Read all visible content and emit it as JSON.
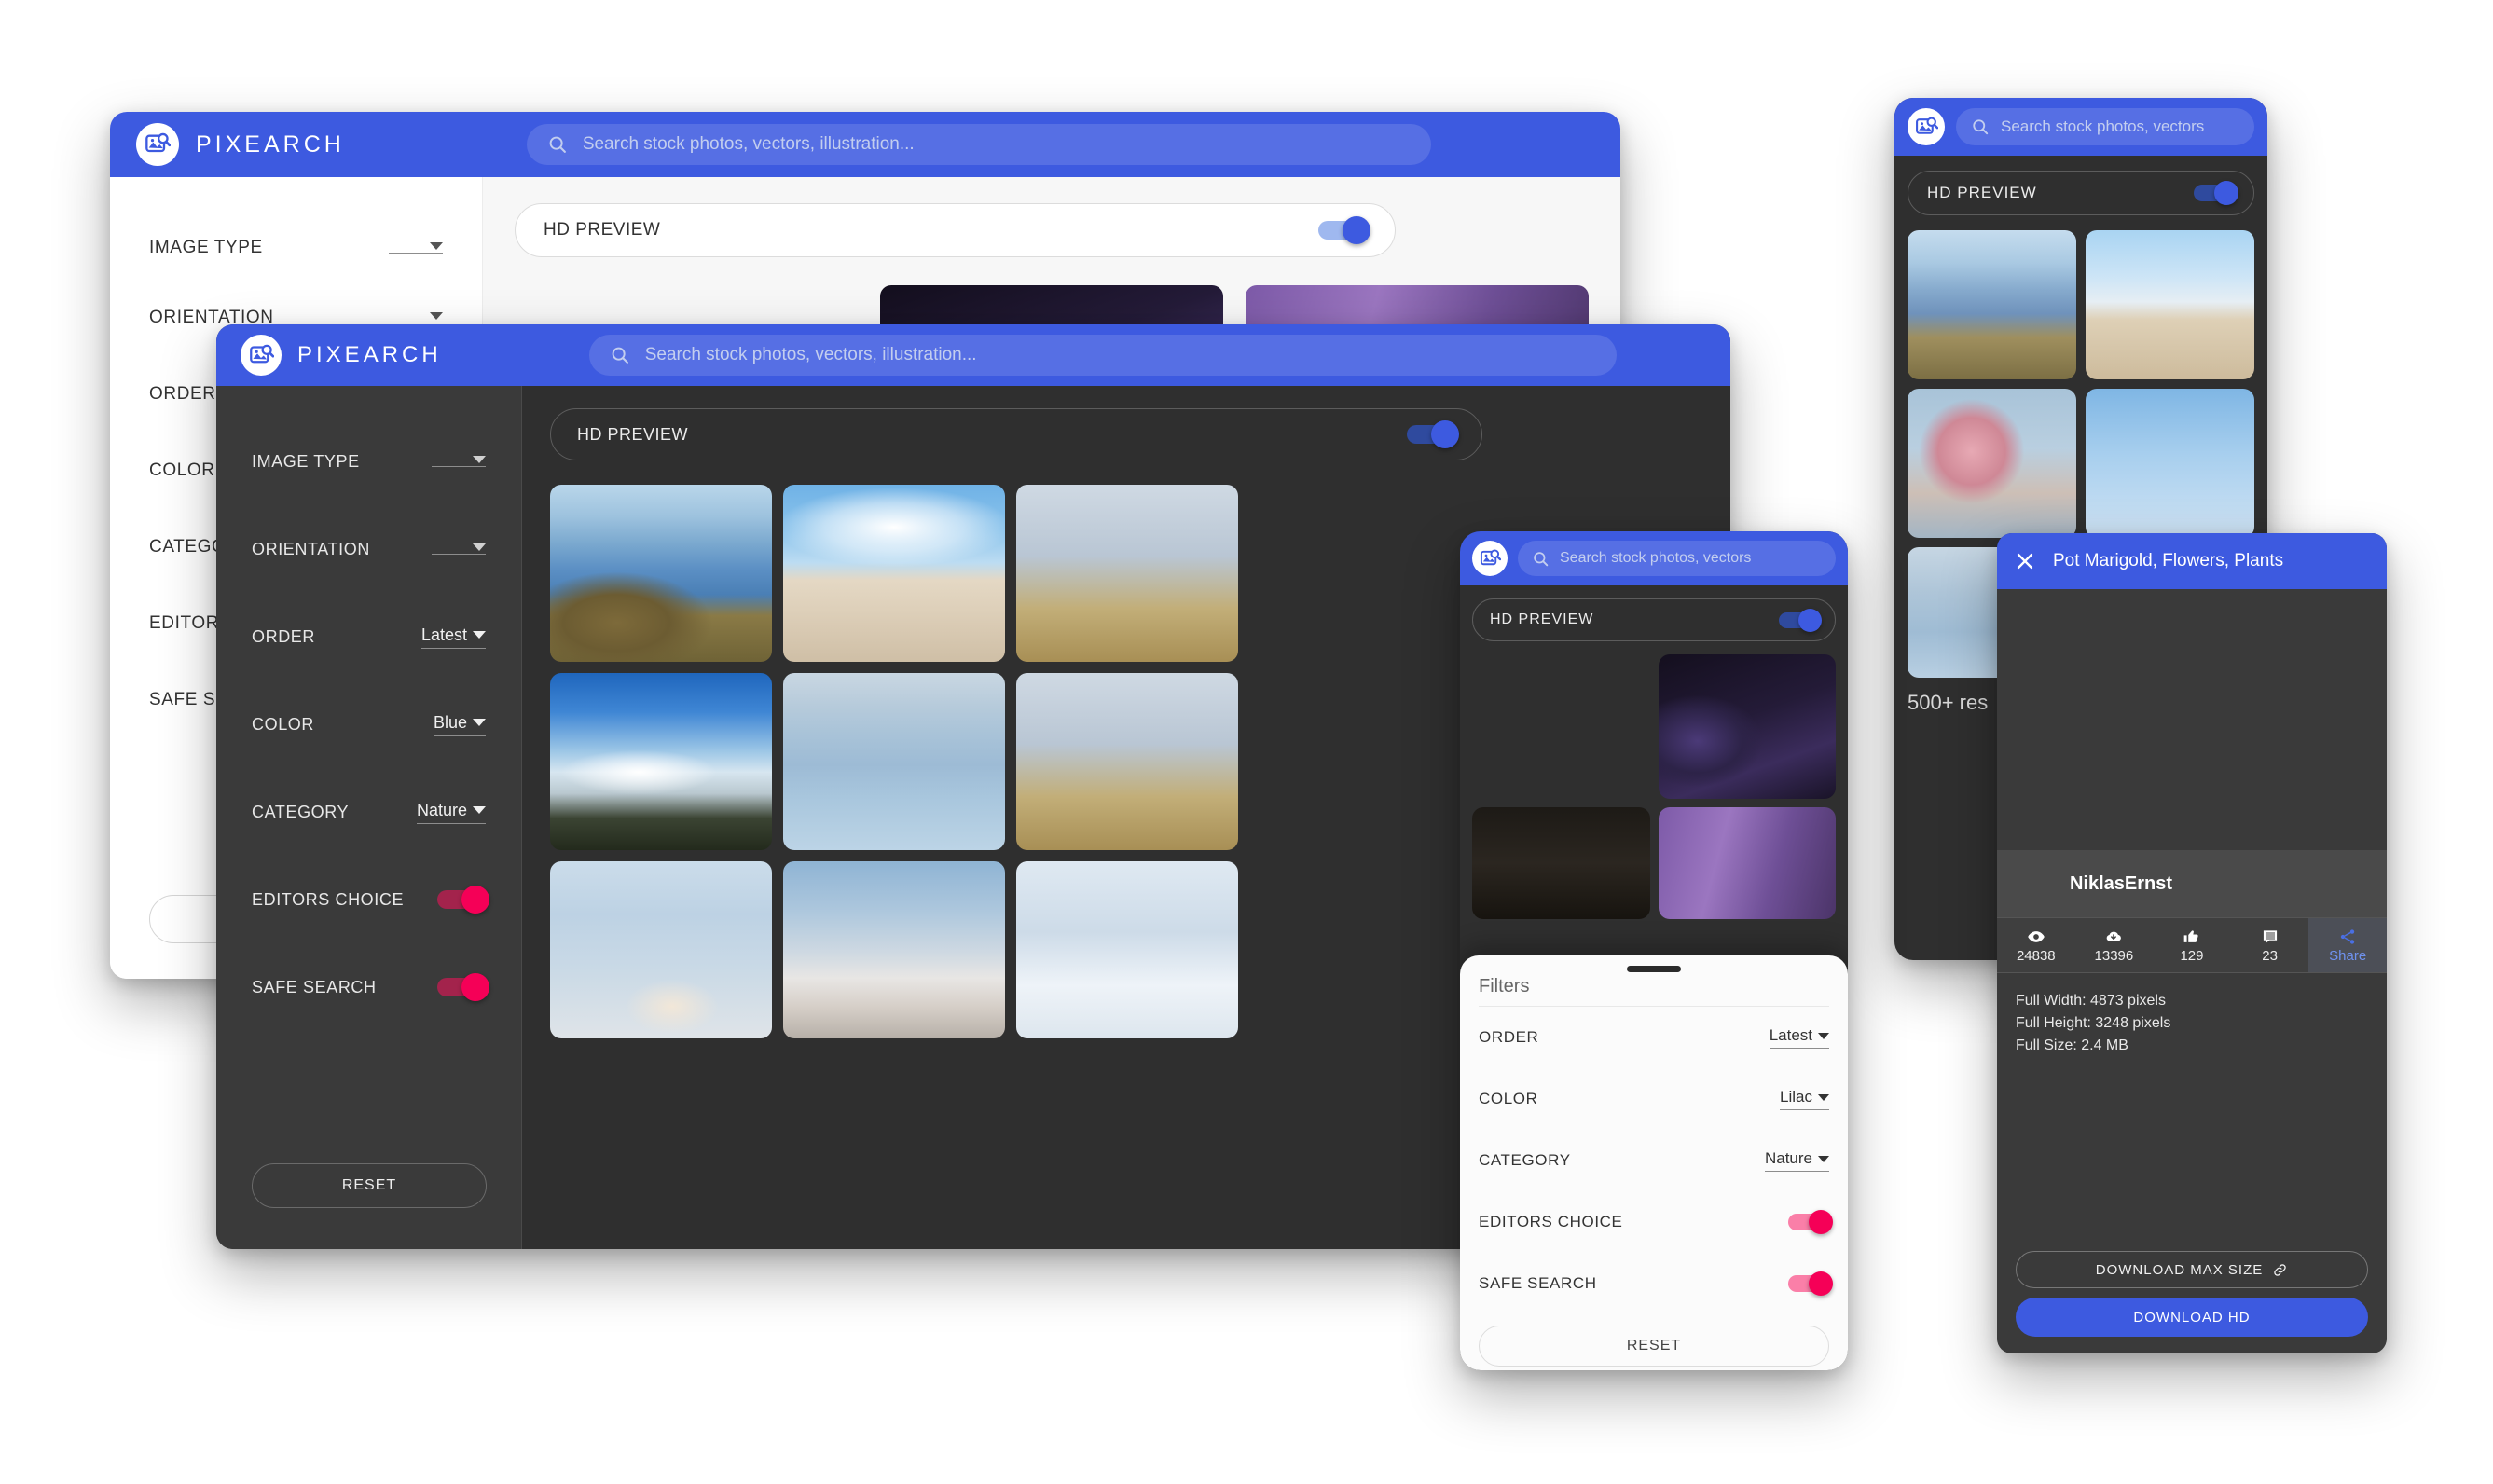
{
  "brand": {
    "name": "PIXEARCH",
    "logo_icon": "image-search-icon"
  },
  "colors": {
    "accent_blue": "#3D5AE0",
    "toggle_pink": "#F50057",
    "dark_bg": "#2F2F2F",
    "sidebar_dark": "#3A3A3A"
  },
  "search": {
    "placeholder_full": "Search stock photos, vectors, illustration...",
    "placeholder_short": "Search stock photos, vectors",
    "icon": "search-icon"
  },
  "hd_preview": {
    "label": "HD PREVIEW",
    "enabled": true
  },
  "filters": {
    "title": "Filters",
    "image_type": {
      "label": "IMAGE TYPE",
      "value": ""
    },
    "orientation": {
      "label": "ORIENTATION",
      "value": ""
    },
    "order": {
      "label": "ORDER",
      "value": "Latest"
    },
    "color": {
      "label": "COLOR",
      "value": "Blue"
    },
    "color_sheet_value": "Lilac",
    "category": {
      "label": "CATEGORY",
      "value": "Nature"
    },
    "editors_choice": {
      "label": "EDITORS CHOICE",
      "enabled": true
    },
    "safe_search": {
      "label": "SAFE SEARCH",
      "enabled": true
    },
    "reset_label": "RESET"
  },
  "results": {
    "count_label": "500+ res"
  },
  "detail": {
    "title": "Pot Marigold, Flowers, Plants",
    "close_icon": "close-icon",
    "author": "NiklasErnst",
    "stats": [
      {
        "icon": "eye-icon",
        "value": "24838",
        "name": "views"
      },
      {
        "icon": "download-cloud-icon",
        "value": "13396",
        "name": "downloads"
      },
      {
        "icon": "thumbs-up-icon",
        "value": "129",
        "name": "likes"
      },
      {
        "icon": "comment-icon",
        "value": "23",
        "name": "comments"
      }
    ],
    "share": {
      "label": "Share",
      "icon": "share-icon"
    },
    "meta": {
      "full_width": "Full Width: 4873 pixels",
      "full_height": "Full Height: 3248 pixels",
      "full_size": "Full Size: 2.4 MB"
    },
    "download_max": {
      "label": "DOWNLOAD MAX SIZE",
      "icon": "link-icon"
    },
    "download_hd": {
      "label": "DOWNLOAD HD"
    }
  }
}
